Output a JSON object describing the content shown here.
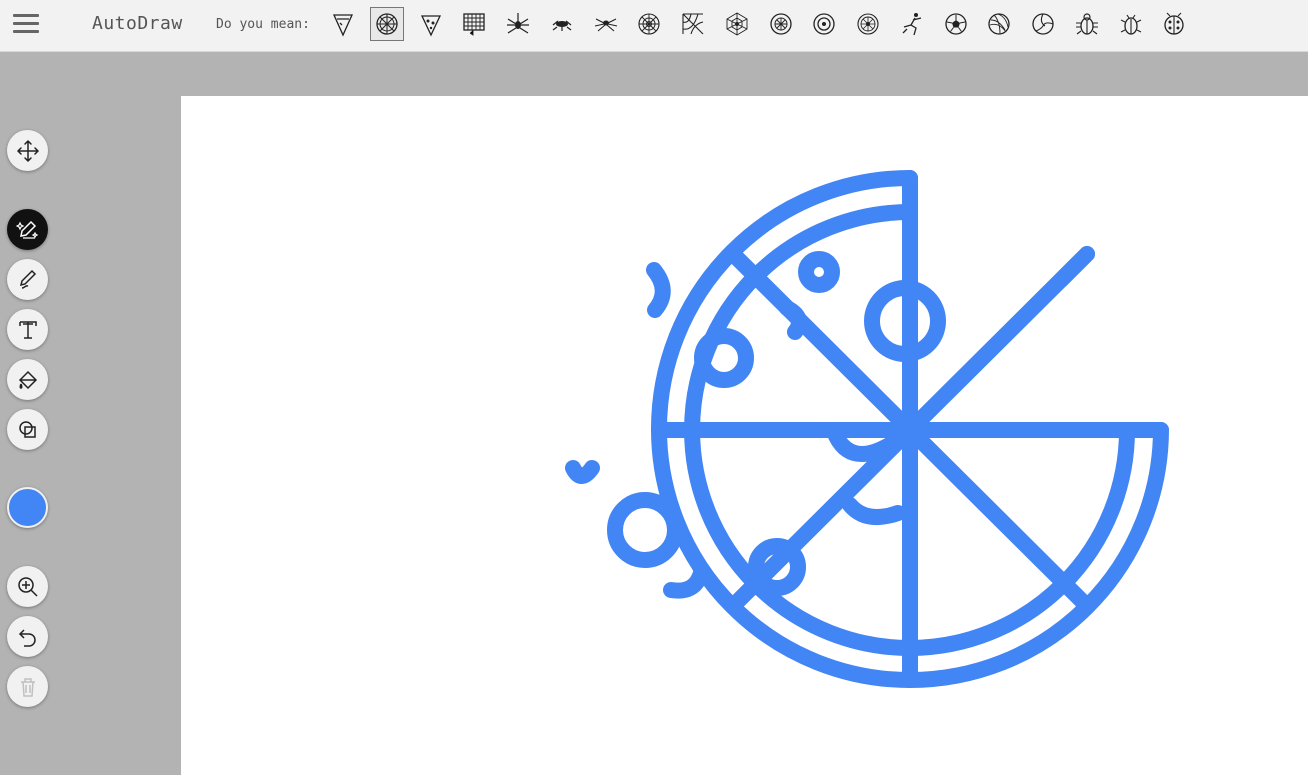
{
  "app": {
    "title": "AutoDraw",
    "suggest_label": "Do you mean:"
  },
  "suggestions": [
    {
      "icon": "pizza-slice-icon",
      "selected": false
    },
    {
      "icon": "pizza-icon",
      "selected": true
    },
    {
      "icon": "pizza-slice-toppings-icon",
      "selected": false
    },
    {
      "icon": "waffle-iron-icon",
      "selected": false
    },
    {
      "icon": "spider-icon",
      "selected": false
    },
    {
      "icon": "ant-icon",
      "selected": false
    },
    {
      "icon": "spider-small-icon",
      "selected": false
    },
    {
      "icon": "spiderweb-icon",
      "selected": false
    },
    {
      "icon": "cobweb-corner-icon",
      "selected": false
    },
    {
      "icon": "spider-on-web-icon",
      "selected": false
    },
    {
      "icon": "wheel-icon",
      "selected": false
    },
    {
      "icon": "rosette-icon",
      "selected": false
    },
    {
      "icon": "wagon-wheel-icon",
      "selected": false
    },
    {
      "icon": "soccer-player-icon",
      "selected": false
    },
    {
      "icon": "soccer-ball-icon",
      "selected": false
    },
    {
      "icon": "yarn-ball-icon",
      "selected": false
    },
    {
      "icon": "volleyball-icon",
      "selected": false
    },
    {
      "icon": "bug-icon",
      "selected": false
    },
    {
      "icon": "beetle-icon",
      "selected": false
    },
    {
      "icon": "ladybug-icon",
      "selected": false
    }
  ],
  "tools": {
    "move": "move-icon",
    "autodraw": "autodraw-icon",
    "draw": "pencil-icon",
    "type": "text-icon",
    "fill": "fill-bucket-icon",
    "shape": "shapes-icon",
    "zoom": "zoom-in-icon",
    "undo": "undo-icon",
    "delete": "trash-icon"
  },
  "colors": {
    "current": "#4285f4",
    "drawing_stroke": "#4285f4"
  },
  "drawing": {
    "subject": "pizza",
    "slices": 7,
    "missing_slices": 1
  }
}
